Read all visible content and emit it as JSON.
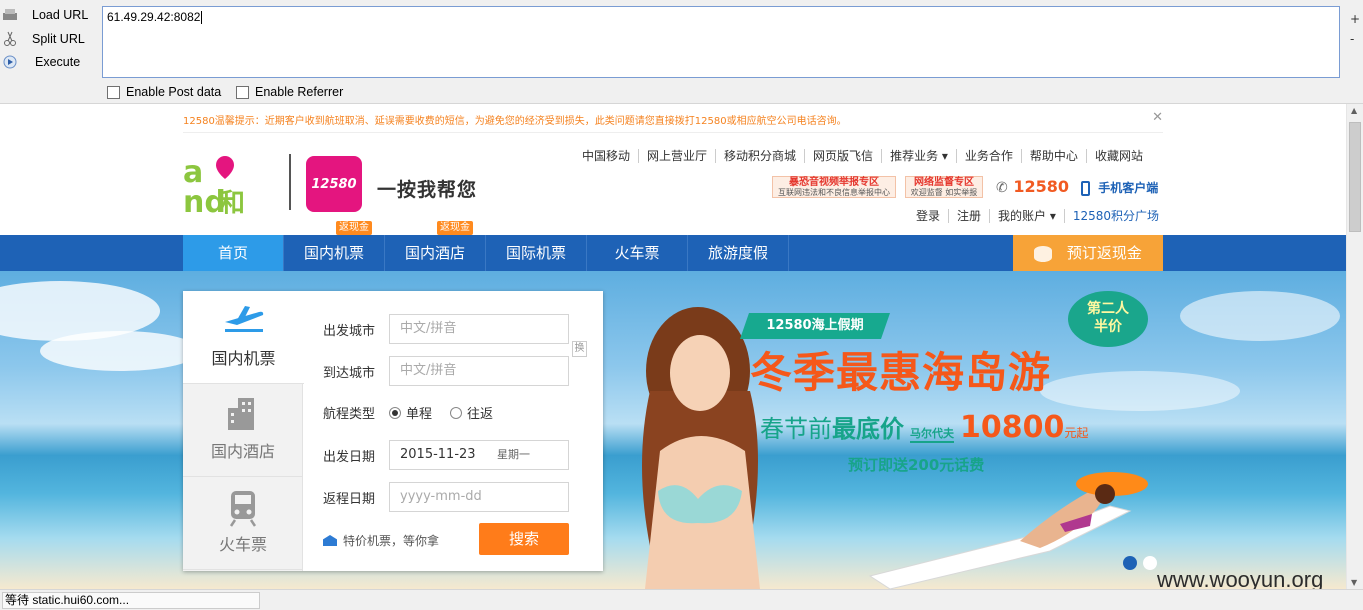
{
  "hackbar": {
    "load_url": "Load URL",
    "split_url": "Split URL",
    "execute": "Execute",
    "url_value": "61.49.29.42:8082",
    "plus": "+",
    "minus": "-",
    "enable_post": "Enable Post data",
    "enable_referrer": "Enable Referrer"
  },
  "site": {
    "notice": "12580温馨提示：近期客户收到航班取消、延误需要收费的短信，为避免您的经济受到损失，此类问题请您直接拨打12580或相应航空公司电话咨询。",
    "notice_close": "✕",
    "logo_and_letters": "and",
    "logo_and_he": "和",
    "logo_12580": "12580",
    "slogan": "一按我帮您",
    "top_nav": [
      "中国移动",
      "网上营业厅",
      "移动积分商城",
      "网页版飞信",
      "推荐业务 ▾",
      "业务合作",
      "帮助中心",
      "收藏网站"
    ],
    "badge1_title": "暴恐音视频举报专区",
    "badge1_sub": "互联网违法和不良信息举报中心",
    "badge2_title": "网络监督专区",
    "badge2_sub": "欢迎监督 如实举报",
    "hotline": "12580",
    "mobile_client": "手机客户端",
    "user_nav": [
      "登录",
      "注册",
      "我的账户 ▾",
      "12580积分广场"
    ]
  },
  "main_nav": {
    "items": [
      "首页",
      "国内机票",
      "国内酒店",
      "国际机票",
      "火车票",
      "旅游度假"
    ],
    "tag": "返现金",
    "cashback": "预订返现金"
  },
  "booking": {
    "tabs": [
      "国内机票",
      "国内酒店",
      "火车票"
    ],
    "from_label": "出发城市",
    "from_placeholder": "中文/拼音",
    "to_label": "到达城市",
    "to_placeholder": "中文/拼音",
    "swap": "换",
    "trip_label": "航程类型",
    "one_way": "单程",
    "round_trip": "往返",
    "depart_label": "出发日期",
    "depart_value": "2015-11-23",
    "depart_weekday": "星期一",
    "return_label": "返程日期",
    "return_placeholder": "yyyy-mm-dd",
    "special": "特价机票，等你拿",
    "search": "搜索"
  },
  "promo": {
    "ribbon": "12580海上假期",
    "bubble_line1": "第二人",
    "bubble_line2": "半价",
    "headline": "冬季最惠海岛游",
    "sub_prefix": "春节前",
    "sub_bold": "最底价",
    "destination": "马尔代夫",
    "price": "10800",
    "price_suffix": "元起",
    "gift": "预订即送200元话费",
    "watermark": "www.wooyun.org"
  },
  "status_bar": "等待 static.hui60.com...",
  "colors": {
    "nav_blue": "#1e62b6",
    "active_tab": "#2d9be8",
    "orange": "#f7a338",
    "headline_orange": "#f5581a",
    "teal": "#17a48a"
  }
}
